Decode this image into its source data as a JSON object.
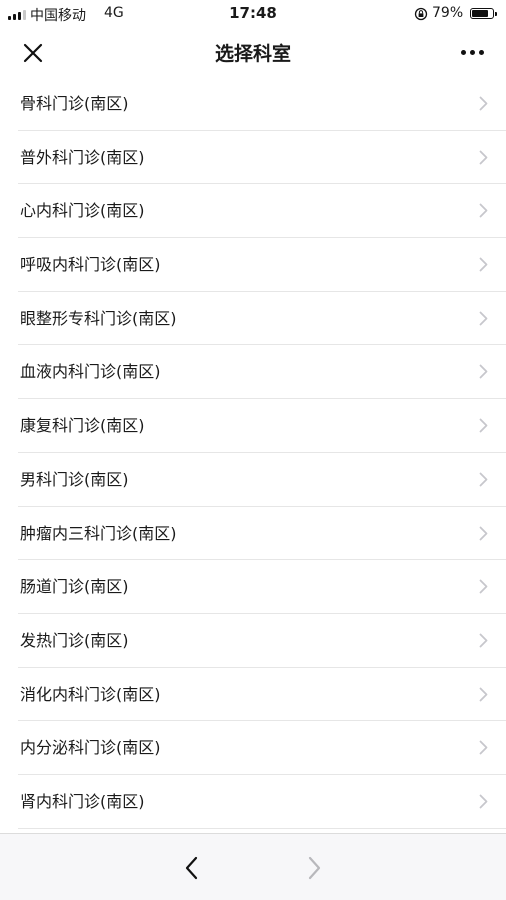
{
  "status_bar": {
    "carrier": "中国移动",
    "network": "4G",
    "time": "17:48",
    "battery_percent": "79%",
    "battery_level": 0.79
  },
  "nav": {
    "title": "选择科室",
    "close_icon": "close-icon",
    "more_icon": "more-icon"
  },
  "departments": [
    {
      "label": "骨科门诊(南区)"
    },
    {
      "label": "普外科门诊(南区)"
    },
    {
      "label": "心内科门诊(南区)"
    },
    {
      "label": "呼吸内科门诊(南区)"
    },
    {
      "label": "眼整形专科门诊(南区)"
    },
    {
      "label": "血液内科门诊(南区)"
    },
    {
      "label": "康复科门诊(南区)"
    },
    {
      "label": "男科门诊(南区)"
    },
    {
      "label": "肿瘤内三科门诊(南区)"
    },
    {
      "label": "肠道门诊(南区)"
    },
    {
      "label": "发热门诊(南区)"
    },
    {
      "label": "消化内科门诊(南区)"
    },
    {
      "label": "内分泌科门诊(南区)"
    },
    {
      "label": "肾内科门诊(南区)"
    }
  ],
  "toolbar": {
    "back_icon": "back-arrow-icon",
    "forward_icon": "forward-arrow-icon"
  },
  "colors": {
    "text": "#1a1a1a",
    "chevron": "#c7c7cc",
    "divider": "#e6e6e6",
    "toolbar_bg": "#f7f7f9",
    "forward_disabled": "#b8b8bc"
  }
}
